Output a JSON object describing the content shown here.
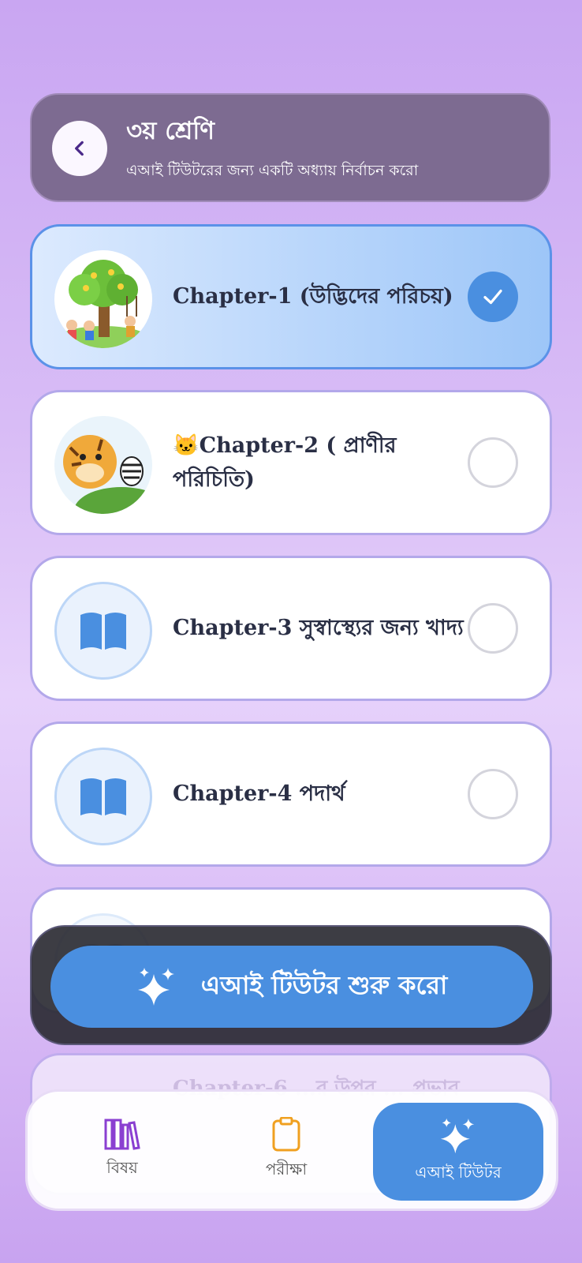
{
  "header": {
    "title": "৩য় শ্রেণি",
    "subtitle": "এআই টিউটরের জন্য একটি অধ্যায় নির্বাচন করো"
  },
  "chapters": [
    {
      "title": "Chapter-1  (উদ্ভিদের পরিচয়)",
      "selected": true,
      "thumb": "tree-kids-image"
    },
    {
      "title": "🐱Chapter-2 ( প্রাণীর পরিচিতি)",
      "selected": false,
      "thumb": "tiger-zebra-image"
    },
    {
      "title": "Chapter-3 সুস্বাস্থ্যের জন্য খাদ্য",
      "selected": false,
      "thumb": "book-icon"
    },
    {
      "title": "Chapter-4 পদার্থ",
      "selected": false,
      "thumb": "book-icon"
    },
    {
      "title": "Chapter-6",
      "faded_text": "Chapter-6 ...র উপর ... প্রভাব",
      "selected": false,
      "thumb": "book-icon"
    }
  ],
  "cta": {
    "label": "এআই টিউটর শুরু করো",
    "icon": "sparkles-icon"
  },
  "nav": [
    {
      "label": "বিষয়",
      "icon": "books-icon",
      "color": "#8a3fd1"
    },
    {
      "label": "পরীক্ষা",
      "icon": "clipboard-icon",
      "color": "#f0a020"
    },
    {
      "label": "এআই টিউটর",
      "icon": "sparkles-icon",
      "active": true
    }
  ],
  "colors": {
    "accent": "#4a8fe0",
    "header_bg": "#7d6b91",
    "card_border": "#b3a8ea"
  }
}
